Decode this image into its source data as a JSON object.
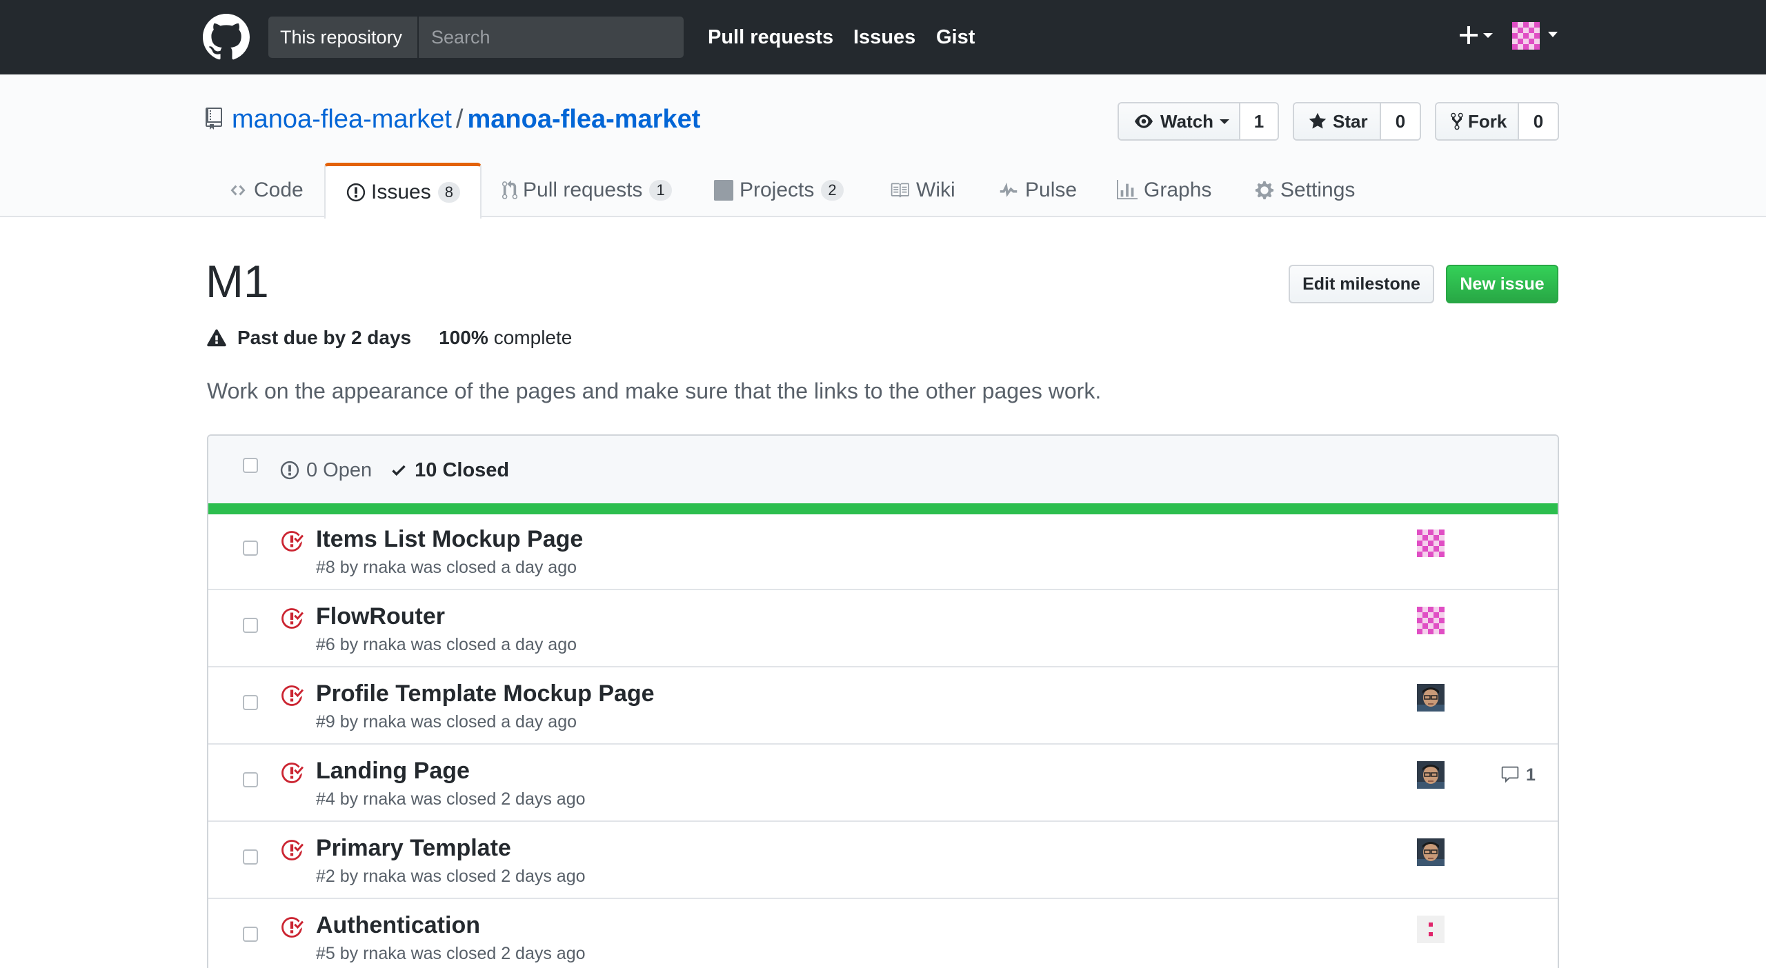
{
  "header": {
    "scope_label": "This repository",
    "search_placeholder": "Search",
    "nav": [
      "Pull requests",
      "Issues",
      "Gist"
    ],
    "icons": [
      "github-mark-icon",
      "plus-icon",
      "caret-down-icon",
      "avatar"
    ]
  },
  "repo": {
    "owner": "manoa-flea-market",
    "name": "manoa-flea-market",
    "watch_label": "Watch",
    "watch_count": "1",
    "star_label": "Star",
    "star_count": "0",
    "fork_label": "Fork",
    "fork_count": "0"
  },
  "tabs": [
    {
      "label": "Code",
      "icon": "code-icon",
      "count": null
    },
    {
      "label": "Issues",
      "icon": "issue-opened-icon",
      "count": "8",
      "selected": true
    },
    {
      "label": "Pull requests",
      "icon": "git-pull-request-icon",
      "count": "1"
    },
    {
      "label": "Projects",
      "icon": "project-icon",
      "count": "2"
    },
    {
      "label": "Wiki",
      "icon": "book-icon",
      "count": null
    },
    {
      "label": "Pulse",
      "icon": "pulse-icon",
      "count": null
    },
    {
      "label": "Graphs",
      "icon": "graph-icon",
      "count": null
    },
    {
      "label": "Settings",
      "icon": "gear-icon",
      "count": null
    }
  ],
  "milestone": {
    "title": "M1",
    "edit_button": "Edit milestone",
    "new_issue_button": "New issue",
    "due_text": "Past due by 2 days",
    "percent": "100%",
    "complete_text": "complete",
    "progress_fraction": 1.0,
    "description": "Work on the appearance of the pages and make sure that the links to the other pages work."
  },
  "issues_filter": {
    "open_label": "0 Open",
    "closed_label": "10 Closed"
  },
  "colors": {
    "header_bg": "#24292e",
    "link_blue": "#0366d6",
    "closed_red": "#cb2431",
    "progress_green": "#2cbe4e",
    "tab_accent": "#e36209",
    "new_issue_green": "#28a745"
  },
  "issues": [
    {
      "title": "Items List Mockup Page",
      "meta": "#8 by rnaka was closed a day ago",
      "assignee": "pink-identicon",
      "comments": null
    },
    {
      "title": "FlowRouter",
      "meta": "#6 by rnaka was closed a day ago",
      "assignee": "pink-identicon",
      "comments": null
    },
    {
      "title": "Profile Template Mockup Page",
      "meta": "#9 by rnaka was closed a day ago",
      "assignee": "photo-avatar",
      "comments": null
    },
    {
      "title": "Landing Page",
      "meta": "#4 by rnaka was closed 2 days ago",
      "assignee": "photo-avatar",
      "comments": "1"
    },
    {
      "title": "Primary Template",
      "meta": "#2 by rnaka was closed 2 days ago",
      "assignee": "photo-avatar",
      "comments": null
    },
    {
      "title": "Authentication",
      "meta": "#5 by rnaka was closed 2 days ago",
      "assignee": "dotted-identicon",
      "comments": null
    }
  ]
}
